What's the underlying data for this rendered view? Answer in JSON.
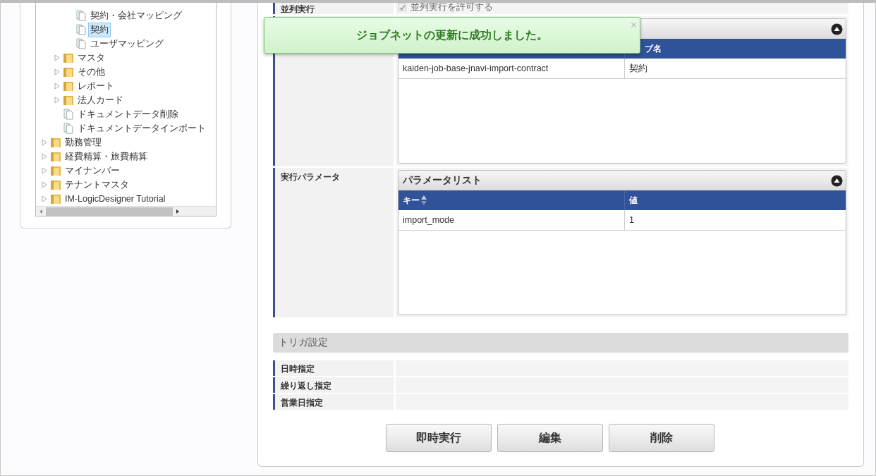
{
  "tree": {
    "items": [
      {
        "children": [
          {
            "children": [
              {
                "label": "契約・会社マッピング",
                "kind": "document",
                "selected": false
              },
              {
                "label": "契約",
                "kind": "document",
                "selected": true
              },
              {
                "label": "ユーザマッピング",
                "kind": "document",
                "selected": false
              }
            ]
          },
          {
            "label": "マスタ",
            "kind": "folder",
            "expanded": false,
            "selected": false
          },
          {
            "label": "その他",
            "kind": "folder",
            "expanded": false,
            "selected": false
          },
          {
            "label": "レポート",
            "kind": "folder",
            "expanded": false,
            "selected": false
          },
          {
            "label": "法人カード",
            "kind": "folder",
            "expanded": false,
            "selected": false
          },
          {
            "label": "ドキュメントデータ削除",
            "kind": "document",
            "selected": false
          },
          {
            "label": "ドキュメントデータインポート",
            "kind": "document",
            "selected": false
          }
        ]
      },
      {
        "label": "勤務管理",
        "kind": "folder",
        "expanded": false,
        "selected": false
      },
      {
        "label": "経費精算・旅費精算",
        "kind": "folder",
        "expanded": false,
        "selected": false
      },
      {
        "label": "マイナンバー",
        "kind": "folder",
        "expanded": false,
        "selected": false
      },
      {
        "label": "テナントマスタ",
        "kind": "folder",
        "expanded": false,
        "selected": false
      },
      {
        "label": "IM-LogicDesigner Tutorial",
        "kind": "folder",
        "expanded": false,
        "selected": false
      }
    ]
  },
  "parallel": {
    "label": "並列実行",
    "checkbox": {
      "label": "並列実行を許可する",
      "checked": true,
      "disabled": true
    }
  },
  "job_table": {
    "columns": [
      "",
      "ブ名"
    ],
    "rows": [
      [
        "kaiden-job-base-jnavi-import-contract",
        "契約"
      ]
    ]
  },
  "parameters": {
    "label": "実行パラメータ",
    "title": "パラメータリスト",
    "columns": [
      "キー",
      "値"
    ],
    "rows": [
      [
        "import_mode",
        "1"
      ]
    ]
  },
  "trigger": {
    "title": "トリガ設定",
    "rows": [
      "日時指定",
      "繰り返し指定",
      "営業日指定"
    ]
  },
  "buttons": [
    "即時実行",
    "編集",
    "削除"
  ],
  "toast": {
    "message": "ジョブネットの更新に成功しました。",
    "close": "×"
  }
}
